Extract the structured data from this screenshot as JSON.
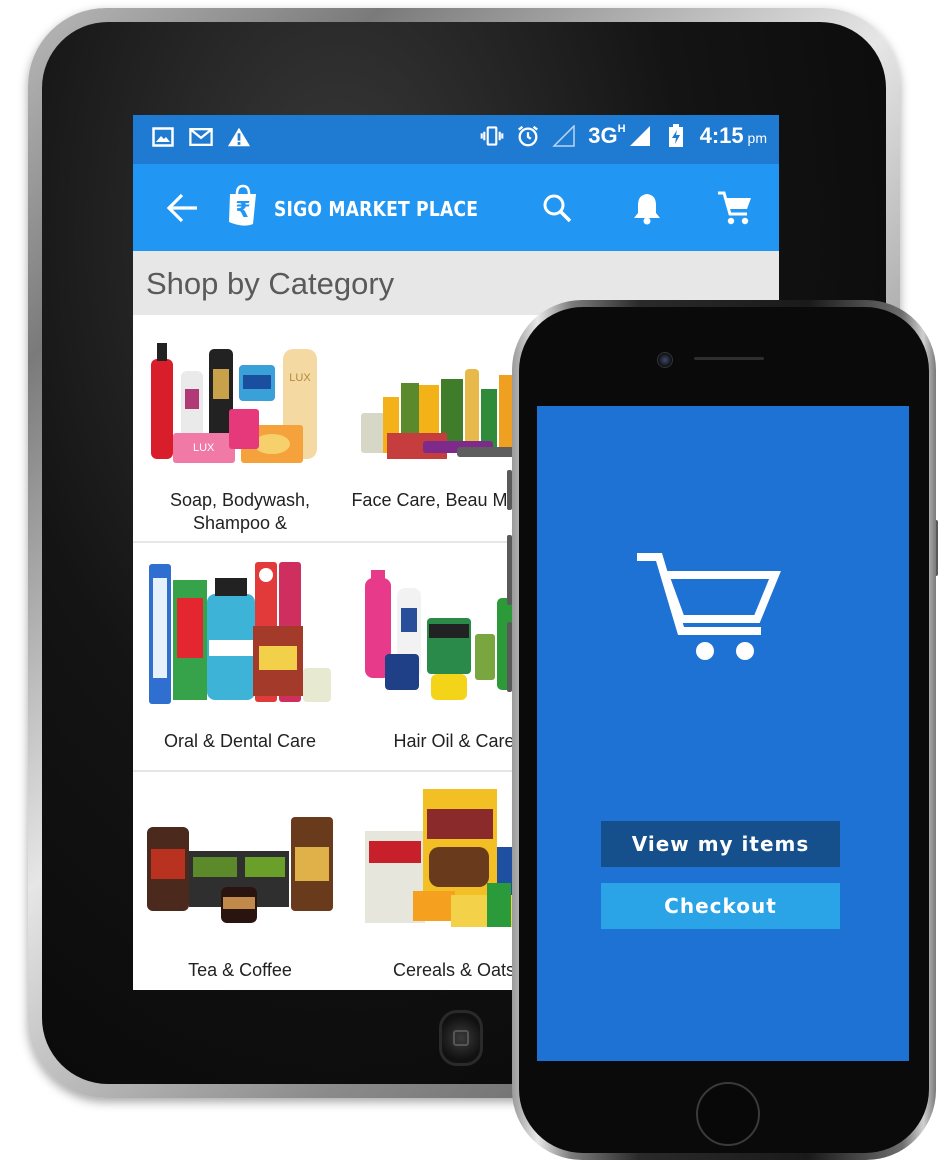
{
  "tablet": {
    "status_bar": {
      "left_icons": [
        "image-icon",
        "gmail-icon",
        "warning-icon"
      ],
      "right_icons": [
        "vibrate-icon",
        "alarm-icon",
        "signal-icon",
        "battery-charging-icon"
      ],
      "network": "3G",
      "network_sup": "H",
      "time": "4:15",
      "time_suffix": "pm"
    },
    "app_bar": {
      "title": "SIGO MARKET PLACE",
      "icons": [
        "back-arrow-icon",
        "rupee-bag-logo-icon",
        "search-icon",
        "bell-icon",
        "cart-icon"
      ]
    },
    "section_title": "Shop by Category",
    "categories": [
      {
        "label": "Soap, Bodywash, Shampoo &"
      },
      {
        "label": "Face Care, Beau Makeup"
      },
      {
        "label": "Oral & Dental Care"
      },
      {
        "label": "Hair Oil & Care"
      },
      {
        "label": "Tea & Coffee"
      },
      {
        "label": "Cereals & Oats"
      }
    ]
  },
  "phone": {
    "icon": "shopping-cart-icon",
    "buttons": {
      "view_items": "View my items",
      "checkout": "Checkout"
    }
  },
  "colors": {
    "status_bar": "#1f7ad1",
    "app_bar": "#2196f3",
    "phone_screen": "#1d72d3",
    "view_button": "#15508d",
    "checkout_button": "#2aa4e6"
  }
}
